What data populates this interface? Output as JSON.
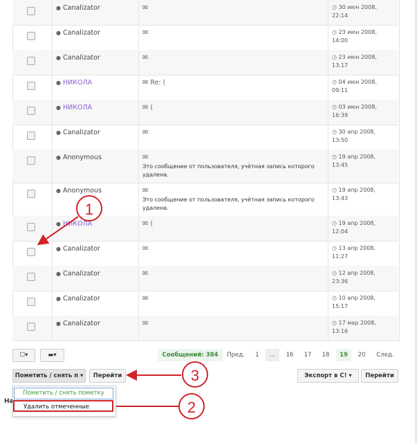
{
  "rows": [
    {
      "author": "Canalizator",
      "purple": false,
      "subject": "",
      "note": "",
      "date1": "30 июн 2008,",
      "date2": "22:14"
    },
    {
      "author": "Canalizator",
      "purple": false,
      "subject": "",
      "note": "",
      "date1": "23 июн 2008,",
      "date2": "14:00"
    },
    {
      "author": "Canalizator",
      "purple": false,
      "subject": "",
      "note": "",
      "date1": "23 июн 2008,",
      "date2": "13:17"
    },
    {
      "author": "НИКОЛА",
      "purple": true,
      "subject": "Re: (",
      "note": "",
      "date1": "04 июн 2008,",
      "date2": "09:11"
    },
    {
      "author": "НИКОЛА",
      "purple": true,
      "subject": "(",
      "note": "",
      "date1": "03 июн 2008,",
      "date2": "16:39"
    },
    {
      "author": "Canalizator",
      "purple": false,
      "subject": "",
      "note": "",
      "date1": "30 апр 2008,",
      "date2": "13:50"
    },
    {
      "author": "Anonymous",
      "purple": false,
      "subject": "",
      "note": "Это сообщение от пользователя, учётная запись которого удалена.",
      "date1": "19 апр 2008,",
      "date2": "13:45"
    },
    {
      "author": "Anonymous",
      "purple": false,
      "subject": "",
      "note": "Это сообщение от пользователя, учётная запись которого удалена.",
      "date1": "19 апр 2008,",
      "date2": "13:43"
    },
    {
      "author": "НИКОЛА",
      "purple": true,
      "subject": "(",
      "note": "",
      "date1": "19 апр 2008,",
      "date2": "12:04"
    },
    {
      "author": "Canalizator",
      "purple": false,
      "subject": "",
      "note": "",
      "date1": "13 апр 2008,",
      "date2": "11:27"
    },
    {
      "author": "Canalizator",
      "purple": false,
      "subject": "",
      "note": "",
      "date1": "12 апр 2008,",
      "date2": "23:36"
    },
    {
      "author": "Canalizator",
      "purple": false,
      "subject": "",
      "note": "",
      "date1": "10 апр 2008,",
      "date2": "15:17"
    },
    {
      "author": "Canalizator",
      "purple": false,
      "subject": "",
      "note": "",
      "date1": "17 мар 2008,",
      "date2": "13:16"
    }
  ],
  "toolbar": {
    "select_icon": "☐▾",
    "folder_icon": "▬▾",
    "messages_label": "Сообщений: 384",
    "prev": "Пред.",
    "pages": [
      "1",
      "...",
      "16",
      "17",
      "18",
      "19",
      "20"
    ],
    "current_page": "19",
    "next": "След.",
    "mark_select": "Пометить / снять п ▾",
    "go1": "Перейти",
    "export": "Экспорт в С! ▾",
    "go2": "Перейти",
    "footer_partial": "На"
  },
  "dropdown": {
    "options": [
      "Пометить / снять пометку",
      "Удалить отмеченные"
    ],
    "highlighted_color": "#3c9a3c",
    "selected": "Удалить отмеченные"
  },
  "callouts": [
    "1",
    "2",
    "3"
  ],
  "colors": {
    "annotation": "#d0232a",
    "author_purple": "#8a5fcf",
    "pager_green": "#3c8a3c"
  }
}
